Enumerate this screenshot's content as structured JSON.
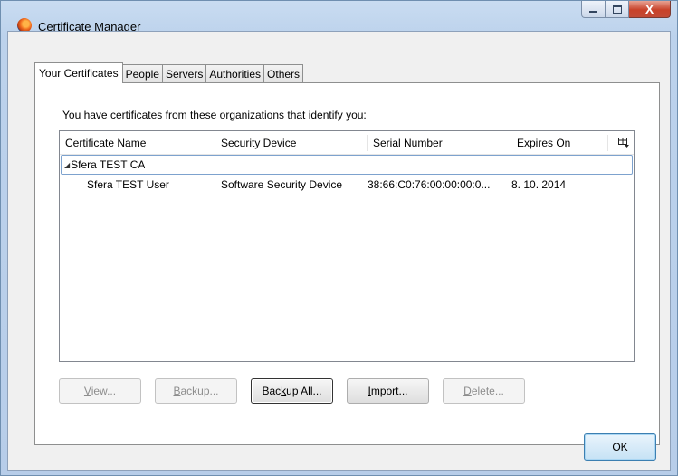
{
  "window": {
    "title": "Certificate Manager",
    "close_glyph": "X"
  },
  "tabs": [
    {
      "label": "Your Certificates",
      "active": true
    },
    {
      "label": "People",
      "active": false
    },
    {
      "label": "Servers",
      "active": false
    },
    {
      "label": "Authorities",
      "active": false
    },
    {
      "label": "Others",
      "active": false
    }
  ],
  "panel": {
    "intro": "You have certificates from these organizations that identify you:"
  },
  "tree": {
    "columns": [
      "Certificate Name",
      "Security Device",
      "Serial Number",
      "Expires On"
    ],
    "column_picker_icon": "column-picker-icon",
    "group": {
      "name": "Sfera TEST CA",
      "expanded": true,
      "twisty": "◢"
    },
    "rows": [
      {
        "name": "Sfera TEST User",
        "device": "Software Security Device",
        "serial": "38:66:C0:76:00:00:00:0...",
        "expires": "8. 10. 2014"
      }
    ]
  },
  "buttons": {
    "view": {
      "pre": "",
      "key": "V",
      "post": "iew...",
      "enabled": false
    },
    "backup": {
      "pre": "",
      "key": "B",
      "post": "ackup...",
      "enabled": false
    },
    "backup_all": {
      "pre": "Bac",
      "key": "k",
      "post": "up All...",
      "enabled": true
    },
    "import": {
      "pre": "",
      "key": "I",
      "post": "mport...",
      "enabled": true
    },
    "delete": {
      "pre": "",
      "key": "D",
      "post": "elete...",
      "enabled": false
    },
    "ok": "OK"
  },
  "colors": {
    "titlebar": "#bcd2ec",
    "close_button": "#c8422a",
    "selection_border": "#7da2ce",
    "ok_border": "#3c7fb1"
  }
}
